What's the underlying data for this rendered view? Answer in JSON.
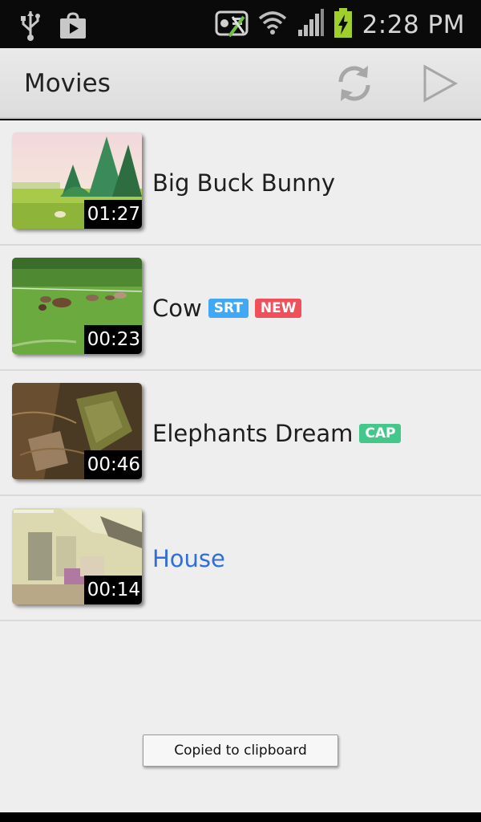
{
  "status_bar": {
    "time": "2:28 PM",
    "icons": [
      "usb-icon",
      "store-icon",
      "no-sync-icon",
      "wifi-icon",
      "signal-icon",
      "battery-charging-icon"
    ]
  },
  "action_bar": {
    "title": "Movies",
    "actions": [
      "refresh-icon",
      "play-icon"
    ]
  },
  "movies": [
    {
      "title": "Big Buck Bunny",
      "duration": "01:27",
      "badges": [],
      "selected": false,
      "thumb_icon": "bunny-thumbnail"
    },
    {
      "title": "Cow",
      "duration": "00:23",
      "badges": [
        {
          "label": "SRT",
          "color": "#3fa9f5"
        },
        {
          "label": "NEW",
          "color": "#f0505a"
        }
      ],
      "selected": false,
      "thumb_icon": "cow-thumbnail"
    },
    {
      "title": "Elephants Dream",
      "duration": "00:46",
      "badges": [
        {
          "label": "CAP",
          "color": "#43c78b"
        }
      ],
      "selected": false,
      "thumb_icon": "elephants-thumbnail"
    },
    {
      "title": "House",
      "duration": "00:14",
      "badges": [],
      "selected": true,
      "thumb_icon": "house-thumbnail"
    }
  ],
  "toast": {
    "text": "Copied to clipboard"
  },
  "colors": {
    "selected_title": "#2f6fdb",
    "badge_srt": "#3fa9f5",
    "badge_new": "#f0505a",
    "badge_cap": "#43c78b"
  }
}
